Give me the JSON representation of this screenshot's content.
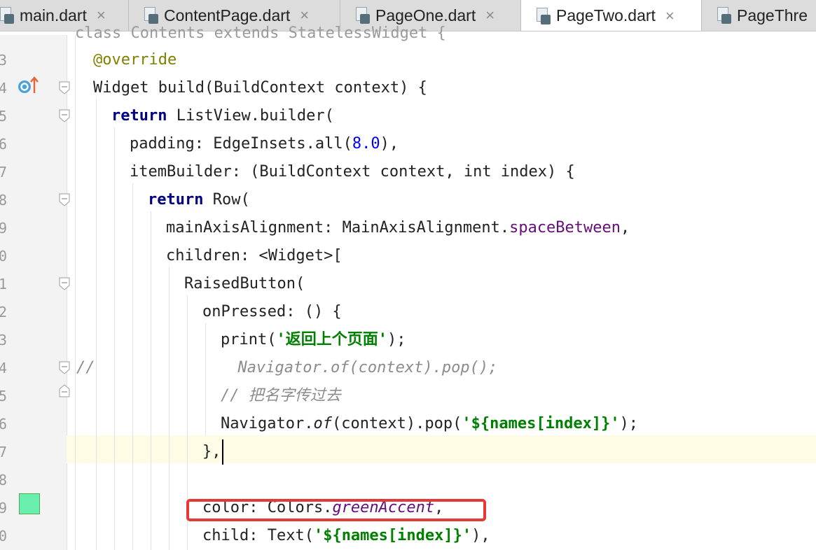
{
  "tabs": [
    {
      "label": "main.dart",
      "active": false
    },
    {
      "label": "ContentPage.dart",
      "active": false
    },
    {
      "label": "PageOne.dart",
      "active": false
    },
    {
      "label": "PageTwo.dart",
      "active": true
    },
    {
      "label": "PageThre",
      "active": false
    }
  ],
  "close_glyph": "×",
  "line_numbers": [
    "3",
    "4",
    "5",
    "6",
    "7",
    "8",
    "9",
    "0",
    "1",
    "2",
    "3",
    "4",
    "5",
    "6",
    "7",
    "8",
    "9",
    "0"
  ],
  "code": {
    "top_partial": "class Contents extends StatelessWidget {",
    "l3": "@override",
    "l4_type": "Widget",
    "l4_rest": " build(BuildContext context) {",
    "l5_kw": "return",
    "l5_rest": " ListView.builder(",
    "l6_a": "padding: EdgeInsets.all(",
    "l6_num": "8.0",
    "l6_b": "),",
    "l7": "itemBuilder: (BuildContext context, int index) {",
    "l8_kw": "return",
    "l8_rest": " Row(",
    "l9_a": "mainAxisAlignment: MainAxisAlignment.",
    "l9_prop": "spaceBetween",
    "l9_b": ",",
    "l10": "children: <Widget>[",
    "l11": "RaisedButton(",
    "l12": "onPressed: () {",
    "l13_a": "print(",
    "l13_str": "'返回上个页面'",
    "l13_b": ");",
    "l14_prefix": "//",
    "l14_cmt": "Navigator.of(context).pop();",
    "l15_cmt": "// 把名字传过去",
    "l16_a": "Navigator.",
    "l16_of": "of",
    "l16_b": "(context).pop(",
    "l16_str": "'${names[index]}'",
    "l16_c": ");",
    "l17": "},",
    "l19_a": "color: Colors.",
    "l19_prop": "greenAccent",
    "l19_b": ",",
    "l20_a": "child: Text(",
    "l20_str": "'${names[index]}'",
    "l20_b": "),"
  },
  "colors": {
    "swatch": "#69f0ae",
    "highlight": "#e53935",
    "keyword": "#000080"
  }
}
